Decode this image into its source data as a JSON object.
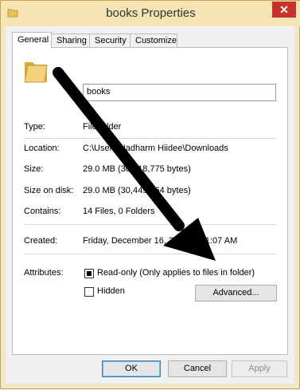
{
  "window": {
    "title": "books Properties",
    "close_label": "✕"
  },
  "tabs": [
    {
      "label": "General"
    },
    {
      "label": "Sharing"
    },
    {
      "label": "Security"
    },
    {
      "label": "Customize"
    }
  ],
  "general": {
    "name_value": "books",
    "type_label": "Type:",
    "type_value": "File folder",
    "location_label": "Location:",
    "location_value": "C:\\Users\\Hadharm Hiidee\\Downloads",
    "size_label": "Size:",
    "size_value": "29.0 MB (30,418,775 bytes)",
    "size_on_disk_label": "Size on disk:",
    "size_on_disk_value": "29.0 MB (30,449,664 bytes)",
    "contains_label": "Contains:",
    "contains_value": "14 Files, 0 Folders",
    "created_label": "Created:",
    "created_value": "Friday, December 16, 2016, 9:31:07 AM",
    "attributes_label": "Attributes:",
    "readonly_label": "Read-only (Only applies to files in folder)",
    "readonly_state": "indeterminate",
    "hidden_label": "Hidden",
    "hidden_checked": false,
    "advanced_label": "Advanced..."
  },
  "buttons": {
    "ok": "OK",
    "cancel": "Cancel",
    "apply": "Apply"
  },
  "colors": {
    "arrow": "#000000",
    "folder": "#e8c25a",
    "close": "#c7312a"
  },
  "icons": [
    "folder-icon",
    "arrow-annotation"
  ]
}
